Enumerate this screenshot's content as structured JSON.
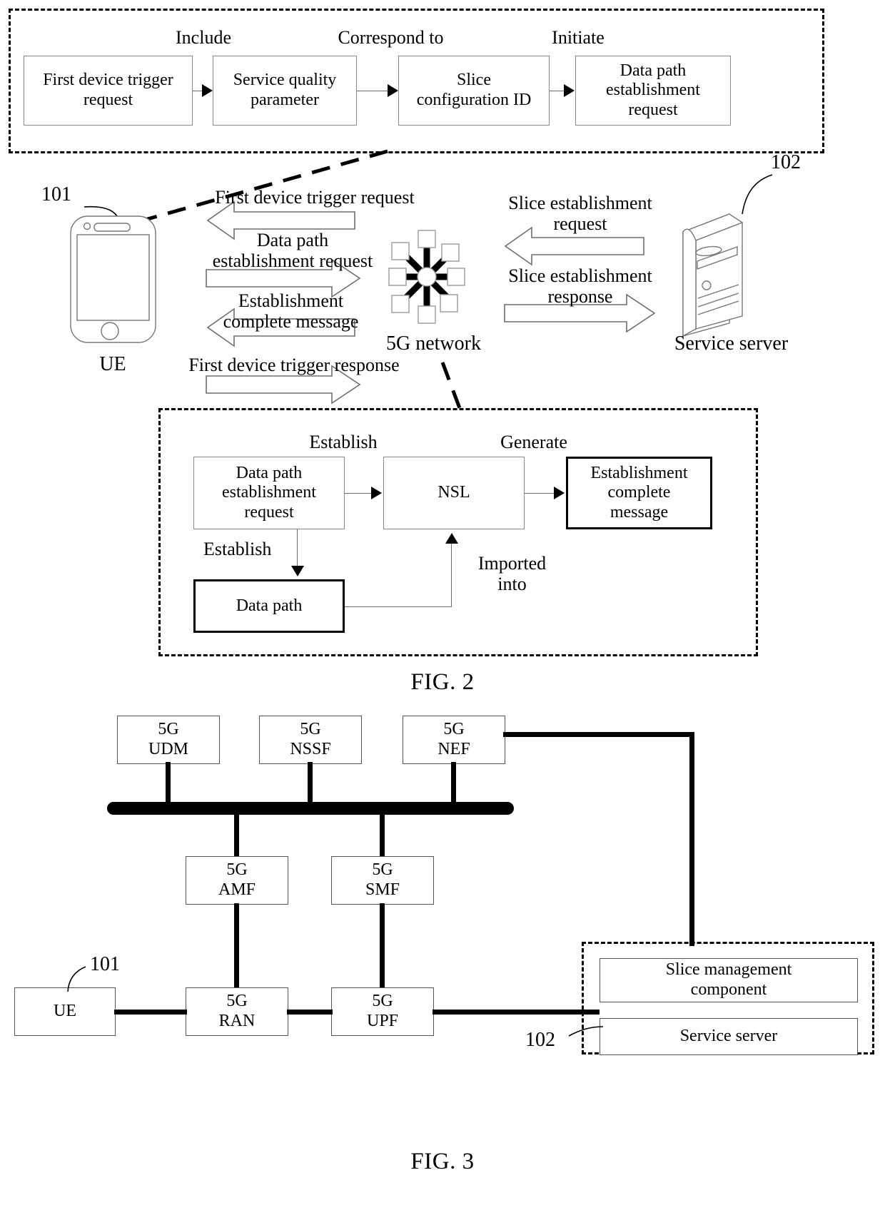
{
  "figure2": {
    "top_flow": {
      "labels": [
        "Include",
        "Correspond to",
        "Initiate"
      ],
      "boxes": [
        "First device trigger\nrequest",
        "Service quality\nparameter",
        "Slice\nconfiguration ID",
        "Data path\nestablishment\nrequest"
      ]
    },
    "middle": {
      "ref_ue": "101",
      "ref_server": "102",
      "ue_label": "UE",
      "network_label": "5G network",
      "server_label": "Service server",
      "messages_left": [
        "First device trigger request",
        "Data path\nestablishment request",
        "Establishment\ncomplete message",
        "First device trigger response"
      ],
      "messages_right": [
        "Slice establishment\nrequest",
        "Slice establishment\nresponse"
      ]
    },
    "bottom_detail": {
      "labels": {
        "establish_top": "Establish",
        "generate": "Generate",
        "establish_down": "Establish",
        "imported_into": "Imported\ninto"
      },
      "boxes": {
        "data_path_request": "Data path\nestablishment\nrequest",
        "nsl": "NSL",
        "establishment_complete": "Establishment\ncomplete\nmessage",
        "data_path": "Data path"
      }
    },
    "caption": "FIG. 2"
  },
  "figure3": {
    "caption": "FIG. 3",
    "ref_ue": "101",
    "ref_server_group": "102",
    "top_row": [
      {
        "line1": "5G",
        "line2": "UDM"
      },
      {
        "line1": "5G",
        "line2": "NSSF"
      },
      {
        "line1": "5G",
        "line2": "NEF"
      }
    ],
    "mid_row": [
      {
        "line1": "5G",
        "line2": "AMF"
      },
      {
        "line1": "5G",
        "line2": "SMF"
      }
    ],
    "bottom_row": [
      {
        "line1": "UE",
        "line2": ""
      },
      {
        "line1": "5G",
        "line2": "RAN"
      },
      {
        "line1": "5G",
        "line2": "UPF"
      }
    ],
    "right_group": [
      "Slice management\ncomponent",
      "Service server"
    ]
  },
  "colors": {
    "ink": "#000000",
    "thin_stroke": "#8a8a8a",
    "page_bg": "#ffffff"
  }
}
